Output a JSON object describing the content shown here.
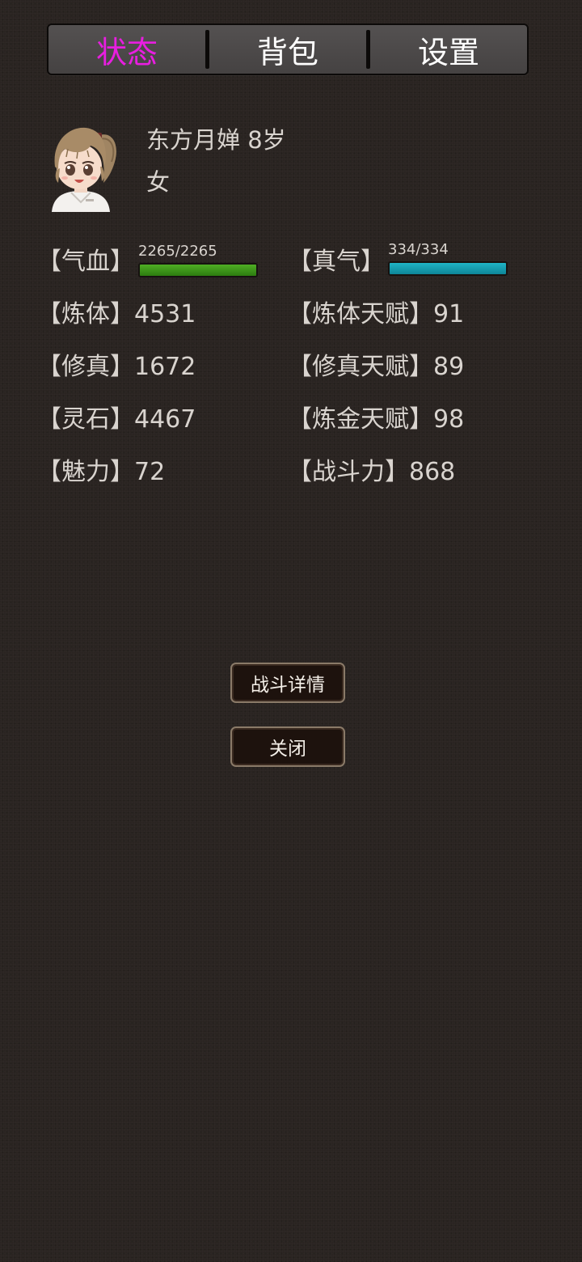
{
  "tabs": [
    {
      "label": "状态",
      "active": true
    },
    {
      "label": "背包",
      "active": false
    },
    {
      "label": "设置",
      "active": false
    }
  ],
  "character": {
    "name_age": "东方月婵 8岁",
    "gender": "女",
    "avatar_icon": "girl-portrait-icon"
  },
  "bars": {
    "hp": {
      "label": "【气血】",
      "value": "2265/2265",
      "current": 2265,
      "max": 2265,
      "color": "#3d9a1a"
    },
    "mp": {
      "label": "【真气】",
      "value": "334/334",
      "current": 334,
      "max": 334,
      "color": "#17a3b5"
    }
  },
  "stats_left": [
    {
      "label": "【炼体】",
      "value": "4531"
    },
    {
      "label": "【修真】",
      "value": "1672"
    },
    {
      "label": "【灵石】",
      "value": "4467"
    },
    {
      "label": "【魅力】",
      "value": "72"
    }
  ],
  "stats_right": [
    {
      "label": "【炼体天赋】",
      "value": "91"
    },
    {
      "label": "【修真天赋】",
      "value": "89"
    },
    {
      "label": "【炼金天赋】",
      "value": "98"
    },
    {
      "label": "【战斗力】",
      "value": "868"
    }
  ],
  "buttons": {
    "battle_details": "战斗详情",
    "close": "关闭"
  },
  "colors": {
    "background": "#2a2421",
    "active_tab": "#e81ee0",
    "text": "#d9d4cf"
  }
}
